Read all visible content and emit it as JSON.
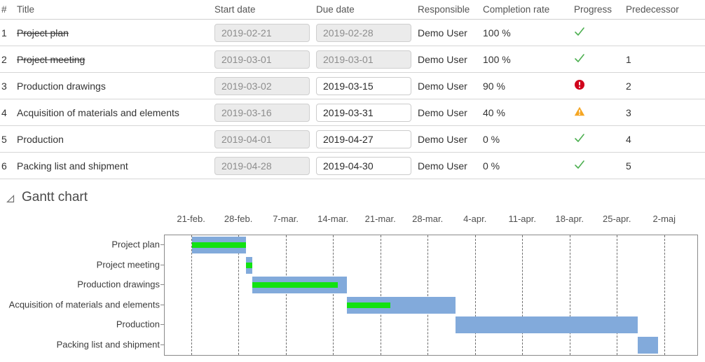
{
  "table": {
    "columns": [
      "#",
      "Title",
      "Start date",
      "Due date",
      "Responsible",
      "Completion rate",
      "Progress",
      "Predecessor"
    ],
    "rows": [
      {
        "num": "1",
        "title": "Project plan",
        "title_struck": true,
        "start_date": "2019-02-21",
        "start_disabled": true,
        "due_date": "2019-02-28",
        "due_disabled": true,
        "responsible": "Demo User",
        "completion_rate": "100 %",
        "progress_icon": "check-icon",
        "predecessor": ""
      },
      {
        "num": "2",
        "title": "Project meeting",
        "title_struck": true,
        "start_date": "2019-03-01",
        "start_disabled": true,
        "due_date": "2019-03-01",
        "due_disabled": true,
        "responsible": "Demo User",
        "completion_rate": "100 %",
        "progress_icon": "check-icon",
        "predecessor": "1"
      },
      {
        "num": "3",
        "title": "Production drawings",
        "title_struck": false,
        "start_date": "2019-03-02",
        "start_disabled": true,
        "due_date": "2019-03-15",
        "due_disabled": false,
        "responsible": "Demo User",
        "completion_rate": "90 %",
        "progress_icon": "alert-icon",
        "predecessor": "2"
      },
      {
        "num": "4",
        "title": "Acquisition of materials and elements",
        "title_struck": false,
        "start_date": "2019-03-16",
        "start_disabled": true,
        "due_date": "2019-03-31",
        "due_disabled": false,
        "responsible": "Demo User",
        "completion_rate": "40 %",
        "progress_icon": "warning-icon",
        "predecessor": "3"
      },
      {
        "num": "5",
        "title": "Production",
        "title_struck": false,
        "start_date": "2019-04-01",
        "start_disabled": true,
        "due_date": "2019-04-27",
        "due_disabled": false,
        "responsible": "Demo User",
        "completion_rate": "0 %",
        "progress_icon": "check-icon",
        "predecessor": "4"
      },
      {
        "num": "6",
        "title": "Packing list and shipment",
        "title_struck": false,
        "start_date": "2019-04-28",
        "start_disabled": true,
        "due_date": "2019-04-30",
        "due_disabled": false,
        "responsible": "Demo User",
        "completion_rate": "0 %",
        "progress_icon": "check-icon",
        "predecessor": "5"
      }
    ]
  },
  "gantt": {
    "section_title": "Gantt chart",
    "collapse_icon": "triangle-collapse-icon"
  },
  "colors": {
    "bar": "#82aadb",
    "progress": "#12e212",
    "check": "#4caf50",
    "alert": "#d0021b",
    "warning": "#f5a623",
    "grid": "#6e6e6e",
    "axis": "#8a8a8a",
    "field_disabled_bg": "#ebebeb",
    "field_disabled_text": "#8d8d8d"
  },
  "chart_data": {
    "type": "bar",
    "title": "Gantt chart",
    "orientation": "horizontal-timeline",
    "xlabel": "",
    "ylabel": "",
    "grid": true,
    "legend": null,
    "x_tick_labels": [
      "21-feb.",
      "28-feb.",
      "7-mar.",
      "14-mar.",
      "21-mar.",
      "28-mar.",
      "4-apr.",
      "11-apr.",
      "18-apr.",
      "25-apr.",
      "2-maj"
    ],
    "x_tick_dates": [
      "2019-02-21",
      "2019-02-28",
      "2019-03-07",
      "2019-03-14",
      "2019-03-21",
      "2019-03-28",
      "2019-04-04",
      "2019-04-11",
      "2019-04-18",
      "2019-04-25",
      "2019-05-02"
    ],
    "x_range": [
      "2019-02-17",
      "2019-05-07"
    ],
    "categories": [
      "Project plan",
      "Project meeting",
      "Production drawings",
      "Acquisition of materials and elements",
      "Production",
      "Packing list and shipment"
    ],
    "tasks": [
      {
        "name": "Project plan",
        "start": "2019-02-21",
        "end": "2019-02-28",
        "completion_pct": 100
      },
      {
        "name": "Project meeting",
        "start": "2019-03-01",
        "end": "2019-03-01",
        "completion_pct": 100
      },
      {
        "name": "Production drawings",
        "start": "2019-03-02",
        "end": "2019-03-15",
        "completion_pct": 90
      },
      {
        "name": "Acquisition of materials and elements",
        "start": "2019-03-16",
        "end": "2019-03-31",
        "completion_pct": 40
      },
      {
        "name": "Production",
        "start": "2019-04-01",
        "end": "2019-04-27",
        "completion_pct": 0
      },
      {
        "name": "Packing list and shipment",
        "start": "2019-04-28",
        "end": "2019-04-30",
        "completion_pct": 0
      }
    ]
  }
}
